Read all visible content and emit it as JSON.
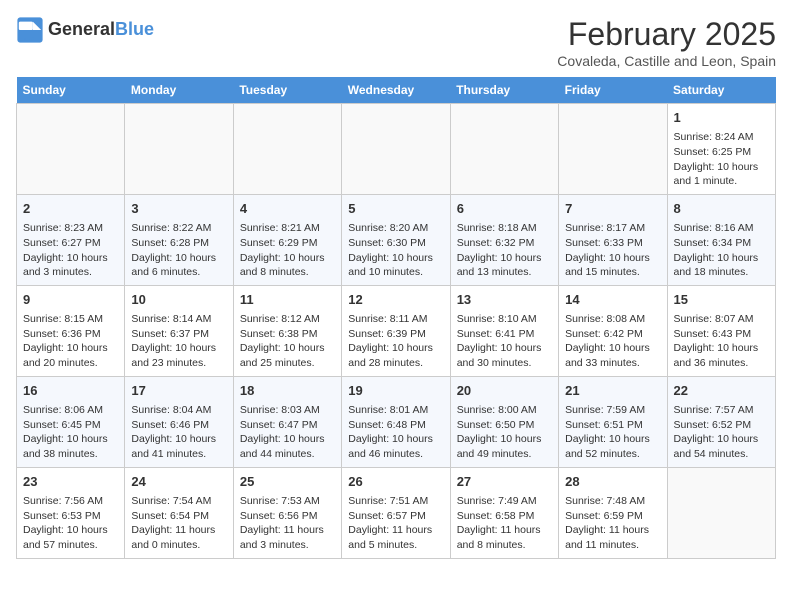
{
  "header": {
    "logo_line1": "General",
    "logo_line2": "Blue",
    "month_title": "February 2025",
    "location": "Covaleda, Castille and Leon, Spain"
  },
  "weekdays": [
    "Sunday",
    "Monday",
    "Tuesday",
    "Wednesday",
    "Thursday",
    "Friday",
    "Saturday"
  ],
  "weeks": [
    [
      {
        "day": "",
        "info": ""
      },
      {
        "day": "",
        "info": ""
      },
      {
        "day": "",
        "info": ""
      },
      {
        "day": "",
        "info": ""
      },
      {
        "day": "",
        "info": ""
      },
      {
        "day": "",
        "info": ""
      },
      {
        "day": "1",
        "info": "Sunrise: 8:24 AM\nSunset: 6:25 PM\nDaylight: 10 hours\nand 1 minute."
      }
    ],
    [
      {
        "day": "2",
        "info": "Sunrise: 8:23 AM\nSunset: 6:27 PM\nDaylight: 10 hours\nand 3 minutes."
      },
      {
        "day": "3",
        "info": "Sunrise: 8:22 AM\nSunset: 6:28 PM\nDaylight: 10 hours\nand 6 minutes."
      },
      {
        "day": "4",
        "info": "Sunrise: 8:21 AM\nSunset: 6:29 PM\nDaylight: 10 hours\nand 8 minutes."
      },
      {
        "day": "5",
        "info": "Sunrise: 8:20 AM\nSunset: 6:30 PM\nDaylight: 10 hours\nand 10 minutes."
      },
      {
        "day": "6",
        "info": "Sunrise: 8:18 AM\nSunset: 6:32 PM\nDaylight: 10 hours\nand 13 minutes."
      },
      {
        "day": "7",
        "info": "Sunrise: 8:17 AM\nSunset: 6:33 PM\nDaylight: 10 hours\nand 15 minutes."
      },
      {
        "day": "8",
        "info": "Sunrise: 8:16 AM\nSunset: 6:34 PM\nDaylight: 10 hours\nand 18 minutes."
      }
    ],
    [
      {
        "day": "9",
        "info": "Sunrise: 8:15 AM\nSunset: 6:36 PM\nDaylight: 10 hours\nand 20 minutes."
      },
      {
        "day": "10",
        "info": "Sunrise: 8:14 AM\nSunset: 6:37 PM\nDaylight: 10 hours\nand 23 minutes."
      },
      {
        "day": "11",
        "info": "Sunrise: 8:12 AM\nSunset: 6:38 PM\nDaylight: 10 hours\nand 25 minutes."
      },
      {
        "day": "12",
        "info": "Sunrise: 8:11 AM\nSunset: 6:39 PM\nDaylight: 10 hours\nand 28 minutes."
      },
      {
        "day": "13",
        "info": "Sunrise: 8:10 AM\nSunset: 6:41 PM\nDaylight: 10 hours\nand 30 minutes."
      },
      {
        "day": "14",
        "info": "Sunrise: 8:08 AM\nSunset: 6:42 PM\nDaylight: 10 hours\nand 33 minutes."
      },
      {
        "day": "15",
        "info": "Sunrise: 8:07 AM\nSunset: 6:43 PM\nDaylight: 10 hours\nand 36 minutes."
      }
    ],
    [
      {
        "day": "16",
        "info": "Sunrise: 8:06 AM\nSunset: 6:45 PM\nDaylight: 10 hours\nand 38 minutes."
      },
      {
        "day": "17",
        "info": "Sunrise: 8:04 AM\nSunset: 6:46 PM\nDaylight: 10 hours\nand 41 minutes."
      },
      {
        "day": "18",
        "info": "Sunrise: 8:03 AM\nSunset: 6:47 PM\nDaylight: 10 hours\nand 44 minutes."
      },
      {
        "day": "19",
        "info": "Sunrise: 8:01 AM\nSunset: 6:48 PM\nDaylight: 10 hours\nand 46 minutes."
      },
      {
        "day": "20",
        "info": "Sunrise: 8:00 AM\nSunset: 6:50 PM\nDaylight: 10 hours\nand 49 minutes."
      },
      {
        "day": "21",
        "info": "Sunrise: 7:59 AM\nSunset: 6:51 PM\nDaylight: 10 hours\nand 52 minutes."
      },
      {
        "day": "22",
        "info": "Sunrise: 7:57 AM\nSunset: 6:52 PM\nDaylight: 10 hours\nand 54 minutes."
      }
    ],
    [
      {
        "day": "23",
        "info": "Sunrise: 7:56 AM\nSunset: 6:53 PM\nDaylight: 10 hours\nand 57 minutes."
      },
      {
        "day": "24",
        "info": "Sunrise: 7:54 AM\nSunset: 6:54 PM\nDaylight: 11 hours\nand 0 minutes."
      },
      {
        "day": "25",
        "info": "Sunrise: 7:53 AM\nSunset: 6:56 PM\nDaylight: 11 hours\nand 3 minutes."
      },
      {
        "day": "26",
        "info": "Sunrise: 7:51 AM\nSunset: 6:57 PM\nDaylight: 11 hours\nand 5 minutes."
      },
      {
        "day": "27",
        "info": "Sunrise: 7:49 AM\nSunset: 6:58 PM\nDaylight: 11 hours\nand 8 minutes."
      },
      {
        "day": "28",
        "info": "Sunrise: 7:48 AM\nSunset: 6:59 PM\nDaylight: 11 hours\nand 11 minutes."
      },
      {
        "day": "",
        "info": ""
      }
    ]
  ]
}
